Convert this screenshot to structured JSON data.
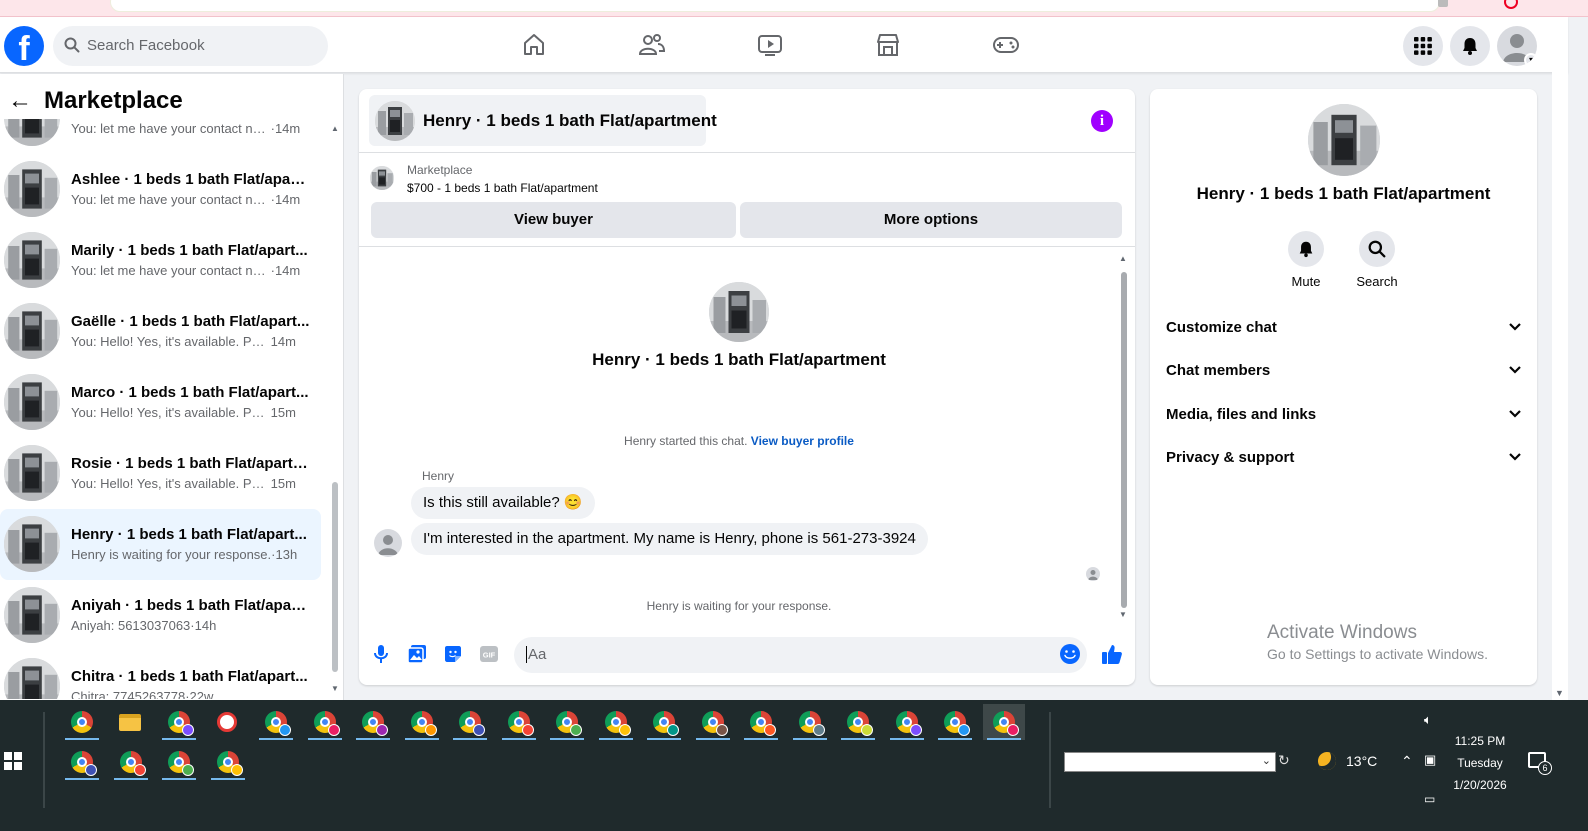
{
  "header": {
    "search_placeholder": "Search Facebook",
    "logo_letter": "f"
  },
  "left_panel": {
    "title": "Marketplace",
    "conversations": [
      {
        "name": "",
        "snippet": "You: let me have your contact nu...",
        "time": "·14m"
      },
      {
        "name": "Ashlee · 1 beds 1 bath Flat/apart...",
        "snippet": "You: let me have your contact nu...",
        "time": "·14m"
      },
      {
        "name": "Marily · 1 beds 1 bath Flat/apart...",
        "snippet": "You: let me have your contact nu...",
        "time": "·14m"
      },
      {
        "name": "Gaëlle · 1 beds 1 bath Flat/apart...",
        "snippet": "You: Hello! Yes, it's available. Plea...",
        "time": "14m"
      },
      {
        "name": "Marco · 1 beds 1 bath Flat/apart...",
        "snippet": "You: Hello! Yes, it's available. Plea...",
        "time": "15m"
      },
      {
        "name": "Rosie · 1 beds 1 bath Flat/apartm...",
        "snippet": "You: Hello! Yes, it's available. Plea...",
        "time": "15m"
      },
      {
        "name": "Henry · 1 beds 1 bath Flat/apart...",
        "snippet": "Henry is waiting for your response.",
        "time": "·13h"
      },
      {
        "name": "Aniyah · 1 beds 1 bath Flat/apart...",
        "snippet": "Aniyah: 5613037063",
        "time": "·14h"
      },
      {
        "name": "Chitra · 1 beds 1 bath Flat/apart...",
        "snippet": "Chitra: 7745263778",
        "time": "·22w"
      }
    ]
  },
  "chat": {
    "title": "Henry · 1 beds 1 bath Flat/apartment",
    "info_glyph": "i",
    "marketplace_label": "Marketplace",
    "listing": "$700 - 1 beds 1 bath Flat/apartment",
    "view_buyer": "View buyer",
    "more_options": "More options",
    "profile_name": "Henry · 1 beds 1 bath Flat/apartment",
    "started_text": "Henry started this chat.",
    "view_buyer_profile": "View buyer profile",
    "sender": "Henry",
    "messages": [
      "Is this still available? 😊",
      "I'm interested in the apartment. My name is Henry, phone is 561-273-3924"
    ],
    "waiting": "Henry is waiting for your response.",
    "composer_placeholder": "Aa"
  },
  "right_panel": {
    "name": "Henry · 1 beds 1 bath Flat/apartment",
    "mute": "Mute",
    "search": "Search",
    "sections": [
      "Customize chat",
      "Chat members",
      "Media, files and links",
      "Privacy & support"
    ]
  },
  "watermark": {
    "line1": "Activate Windows",
    "line2": "Go to Settings to activate Windows."
  },
  "taskbar": {
    "weather": "13°C",
    "time": "11:25 PM",
    "day": "Tuesday",
    "date": "1/20/2026",
    "notifications": "6"
  },
  "colors": {
    "brand_blue": "#0866ff",
    "info_purple": "#a000ff",
    "link_blue": "#0a5bc4",
    "active_row": "#ebf5ff"
  }
}
